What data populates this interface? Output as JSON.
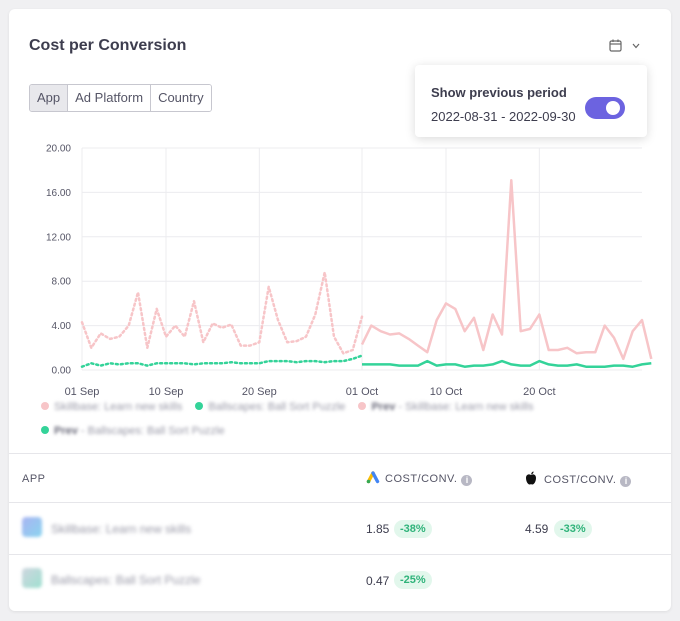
{
  "card": {
    "title": "Cost per Conversion"
  },
  "tabs": [
    {
      "label": "App",
      "active": true
    },
    {
      "label": "Ad Platform",
      "active": false
    },
    {
      "label": "Country",
      "active": false
    }
  ],
  "popup": {
    "title": "Show previous period",
    "date_range": "2022-08-31 - 2022-09-30",
    "toggle_on": true,
    "toggle_color": "#6c63e0"
  },
  "chart_data": {
    "type": "line",
    "y_ticks": [
      "20.00",
      "16.00",
      "12.00",
      "8.00",
      "4.00",
      "0.00"
    ],
    "ylim": [
      0,
      20
    ],
    "x_ticks": [
      {
        "label": "01 Sep",
        "index": 0
      },
      {
        "label": "10 Sep",
        "index": 9
      },
      {
        "label": "20 Sep",
        "index": 19
      },
      {
        "label": "01 Oct",
        "index": 30
      },
      {
        "label": "10 Oct",
        "index": 39
      },
      {
        "label": "20 Oct",
        "index": 49
      }
    ],
    "x_count": 61,
    "grid": true,
    "colors": {
      "pink": "#f7c5c8",
      "green": "#34d399"
    },
    "series": [
      {
        "name": "Prev - Skillbase: Learn new skills",
        "style": "dotted",
        "color": "#f7c5c8",
        "start_index": 0,
        "values": [
          4.3,
          2.0,
          3.3,
          2.8,
          3.0,
          4.0,
          7.0,
          2.0,
          5.5,
          3.0,
          4.0,
          3.0,
          6.2,
          2.5,
          4.2,
          3.8,
          4.1,
          2.2,
          2.2,
          2.5,
          7.5,
          4.5,
          2.5,
          2.6,
          3.0,
          5.0,
          8.8,
          3.0,
          1.5,
          1.8,
          4.8
        ]
      },
      {
        "name": "Prev - Ballscapes: Ball Sort Puzzle",
        "style": "dotted",
        "color": "#34d399",
        "start_index": 0,
        "values": [
          0.3,
          0.6,
          0.4,
          0.6,
          0.5,
          0.6,
          0.6,
          0.4,
          0.6,
          0.6,
          0.6,
          0.6,
          0.5,
          0.6,
          0.6,
          0.6,
          0.7,
          0.6,
          0.6,
          0.6,
          0.8,
          0.8,
          0.8,
          0.7,
          0.8,
          0.8,
          0.7,
          0.8,
          0.8,
          1.0,
          1.3
        ]
      },
      {
        "name": "Skillbase: Learn new skills",
        "style": "solid",
        "color": "#f7c5c8",
        "start_index": 30,
        "values": [
          2.3,
          4.0,
          3.5,
          3.2,
          3.3,
          2.8,
          2.2,
          1.6,
          4.5,
          6.0,
          5.5,
          3.5,
          4.7,
          1.8,
          5.0,
          3.2,
          17.1,
          3.5,
          3.7,
          5.0,
          1.8,
          1.8,
          2.0,
          1.5,
          1.6,
          1.6,
          4.0,
          2.9,
          1.0,
          3.5,
          4.5,
          1.0
        ]
      },
      {
        "name": "Ballscapes: Ball Sort Puzzle",
        "style": "solid",
        "color": "#34d399",
        "start_index": 30,
        "values": [
          0.5,
          0.5,
          0.5,
          0.5,
          0.4,
          0.4,
          0.4,
          0.8,
          0.4,
          0.5,
          0.5,
          0.3,
          0.4,
          0.4,
          0.5,
          0.8,
          0.5,
          0.4,
          0.4,
          0.8,
          0.5,
          0.4,
          0.4,
          0.5,
          0.3,
          0.3,
          0.3,
          0.4,
          0.4,
          0.3,
          0.5,
          0.6
        ]
      }
    ]
  },
  "legend": [
    {
      "prefix": "",
      "label": "Skillbase: Learn new skills",
      "color": "#f7c5c8"
    },
    {
      "prefix": "",
      "label": "Ballscapes: Ball Sort Puzzle",
      "color": "#34d399"
    },
    {
      "prefix": "Prev",
      "label": " - Skillbase: Learn new skills",
      "color": "#f7c5c8"
    },
    {
      "prefix": "Prev",
      "label": " - Ballscapes: Ball Sort Puzzle",
      "color": "#34d399"
    }
  ],
  "table": {
    "header_app": "APP",
    "header_google": "COST/CONV.",
    "header_apple": "COST/CONV.",
    "info_glyph": "i",
    "rows": [
      {
        "name": "Skillbase: Learn new skills",
        "google_value": "1.85",
        "google_change": "-38%",
        "apple_value": "4.59",
        "apple_change": "-33%"
      },
      {
        "name": "Ballscapes: Ball Sort Puzzle",
        "google_value": "0.47",
        "google_change": "-25%"
      }
    ]
  },
  "icons": {
    "calendar": "calendar-icon",
    "chevron": "chevron-down-icon",
    "google_ads": "google-ads-icon",
    "apple": "apple-icon",
    "info": "info-icon"
  }
}
